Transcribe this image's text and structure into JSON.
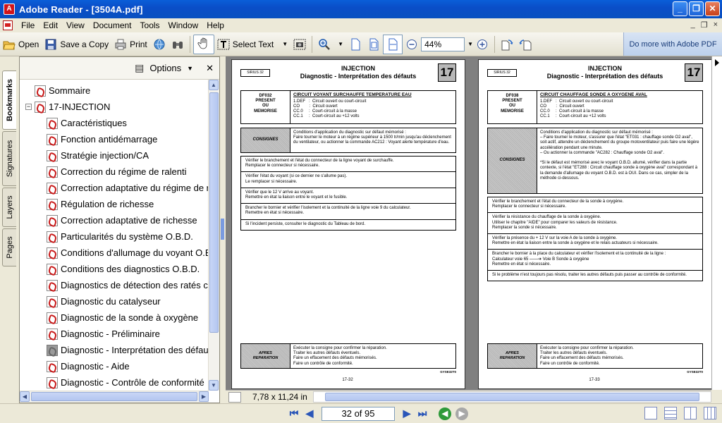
{
  "window": {
    "title": "Adobe Reader - [3504A.pdf]",
    "app_icon": "pdf-app-icon",
    "minimize": "_",
    "maximize": "❐",
    "close": "✕"
  },
  "menu": [
    "File",
    "Edit",
    "View",
    "Document",
    "Tools",
    "Window",
    "Help"
  ],
  "mdi": {
    "minimize": "_",
    "restore": "❐",
    "close": "×"
  },
  "toolbar": {
    "open": "Open",
    "save_copy": "Save a Copy",
    "print": "Print",
    "select_text": "Select Text",
    "zoom_value": "44%",
    "do_more": "Do more with Adobe PDF"
  },
  "side_tabs": [
    "Bookmarks",
    "Signatures",
    "Layers",
    "Pages"
  ],
  "panel": {
    "options": "Options",
    "close": "✕"
  },
  "bookmarks": [
    {
      "label": "Sommaire",
      "level": 0,
      "expander": ""
    },
    {
      "label": "17-INJECTION",
      "level": 0,
      "expander": "−"
    },
    {
      "label": "Caractéristiques",
      "level": 1
    },
    {
      "label": "Fonction antidémarrage",
      "level": 1
    },
    {
      "label": "Stratégie injection/CA",
      "level": 1
    },
    {
      "label": "Correction du régime de ralenti",
      "level": 1
    },
    {
      "label": "Correction adaptative du régime de r",
      "level": 1
    },
    {
      "label": "Régulation de richesse",
      "level": 1
    },
    {
      "label": "Correction adaptative de richesse",
      "level": 1
    },
    {
      "label": "Particularités du système O.B.D.",
      "level": 1
    },
    {
      "label": "Conditions d'allumage du voyant O.E",
      "level": 1
    },
    {
      "label": "Conditions des diagnostics O.B.D.",
      "level": 1
    },
    {
      "label": "Diagnostics de détection des ratés c",
      "level": 1
    },
    {
      "label": "Diagnostic du catalyseur",
      "level": 1
    },
    {
      "label": "Diagnostic de la sonde à oxygène",
      "level": 1
    },
    {
      "label": "Diagnostic - Préliminaire",
      "level": 1
    },
    {
      "label": "Diagnostic - Interprétation des défau",
      "level": 1,
      "grey": true
    },
    {
      "label": "Diagnostic - Aide",
      "level": 1
    },
    {
      "label": "Diagnostic - Contrôle de conformité",
      "level": 1
    }
  ],
  "pages": [
    {
      "sirius": "SIRIUS 32",
      "title1": "INJECTION",
      "title2": "Diagnostic - Interprétation des défauts",
      "num": "17",
      "code": "DF032\nPRESENT\nOU\nMEMORISE",
      "fault_title": "CIRCUIT VOYANT SURCHAUFFE TEMPERATURE EAU",
      "fault_lines": [
        "1.DEF   :  Circuit ouvert ou court-circuit",
        "CO        :  Circuit ouvert",
        "CC.0     :  Court-circuit à la masse",
        "CC.1     :  Court-circuit au +12 volts"
      ],
      "consignes_label": "CONSIGNES",
      "consignes": "Conditions d'application du diagnostic sur défaut mémorisé :\nFaire tourner le moteur à un régime supérieur à 1500 tr/min jusqu'au déclenchement du ventilateur, ou actionner la commande AC212 : Voyant alerte température d'eau.",
      "checks": [
        "Vérifier le branchement et l'état du connecteur de la ligne voyant de surchauffe.\nRemplacer le connecteur si nécessaire.",
        "Vérifier l'état du voyant (si ce dernier ne s'allume pas).\nLe remplacer si nécessaire.",
        "Vérifier que le 12 V arrive au voyant.\nRemettre en état la liaison entre le voyant et le fusible.",
        "Brancher le bornier et vérifier l'isolement et la continuité de la ligne voie 9 du calculateur.\nRemettre en état si nécessaire.",
        "Si l'incident persiste, consulter le diagnostic du Tableau de bord."
      ],
      "apres_label": "APRES\nREPARATION",
      "apres": "Exécuter la consigne pour confirmer la réparation.\nTraiter les autres défauts éventuels.\nFaire un effacement des défauts mémorisés.\nFaire un contrôle de conformité.",
      "ref": "GYSE32T0",
      "footer": "17-32"
    },
    {
      "sirius": "SIRIUS 32",
      "title1": "INJECTION",
      "title2": "Diagnostic - Interprétation des défauts",
      "num": "17",
      "code": "DF038\nPRESENT\nOU\nMEMORISE",
      "fault_title": "CIRCUIT CHAUFFAGE SONDE A OXYGENE AVAL",
      "fault_lines": [
        "1.DEF   :  Circuit ouvert ou court-circuit",
        "CO        :  Circuit ouvert",
        "CC.0     :  Court-circuit à la masse",
        "CC.1     :  Court-circuit au +12 volts"
      ],
      "consignes_label": "CONSIGNES",
      "consignes": "Conditions d'application du diagnostic sur défaut mémorisé :\n– Faire tourner le moteur, s'assurer que l'état \"ET031 : chauffage sonde O2 aval\", soit actif, attendre un déclenchement du groupe motoventilateur puis faire une légère accélération pendant une minute.\n– Ou actionner la commande \"AC282 : Chauffage sonde O2 aval\".\n\n*Si le défaut est mémorisé avec le voyant O.B.D. allumé, vérifier dans la partie contexte, si l'état \"ET288 : Circuit chauffage sonde à oxygène aval\" correspondant à la demande d'allumage du voyant O.B.D. est à OUI. Dans ce cas, simpler de la méthode ci-dessous.",
      "checks": [
        "Vérifier le branchement et l'état du connecteur de la sonde à oxygène.\nRemplacer le connecteur si nécessaire.",
        "Vérifier la résistance du chauffage de la sonde à oxygène.\nUtiliser le chapitre \"AIDE\" pour comparer les valeurs de résistance.\nRemplacer la sonde si nécessaire.",
        "Vérifier la présence du + 12 V sur la voie A de la sonde à oxygène.\nRemettre en état la liaison entre la sonde à oxygène et le relais actuateurs si nécessaire.",
        "Brancher le bornier à la place du calculateur et vérifier l'isolement et la continuité de la ligne :\n      Calculateur voie 65   ——➔  Voie B Sonde à oxygène\nRemettre en état si nécessaire.",
        "Si le problème n'est toujours pas résolu, traiter les autres défauts puis passer au contrôle de conformité."
      ],
      "apres_label": "APRES\nREPARATION",
      "apres": "Exécuter la consigne pour confirmer la réparation.\nTraiter les autres défauts éventuels.\nFaire un effacement des défauts mémorisés.\nFaire un contrôle de conformité.",
      "ref": "GYSE32T0",
      "footer": "17-33"
    }
  ],
  "doc_status": {
    "page_size": "7,78 x 11,24 in"
  },
  "nav": {
    "page_indicator": "32 of 95"
  }
}
